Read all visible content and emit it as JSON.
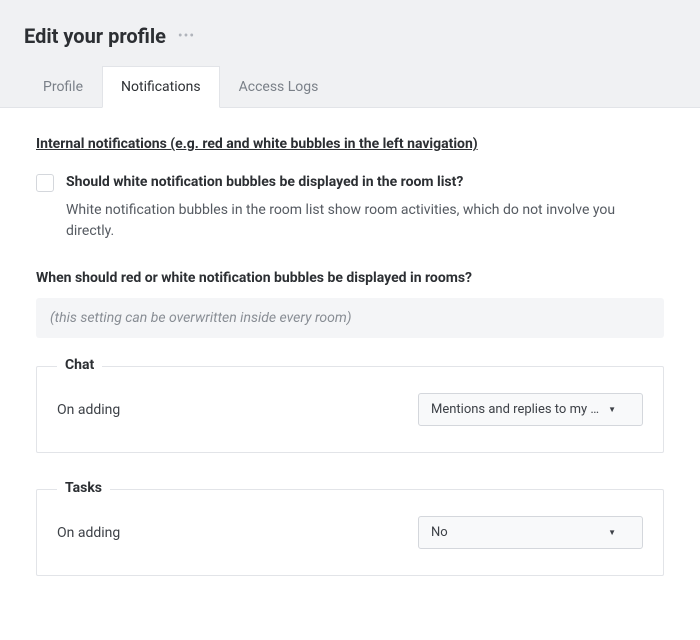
{
  "header": {
    "title": "Edit your profile"
  },
  "tabs": [
    {
      "label": "Profile",
      "active": false
    },
    {
      "label": "Notifications",
      "active": true
    },
    {
      "label": "Access Logs",
      "active": false
    }
  ],
  "section": {
    "heading": "Internal notifications (e.g. red and white bubbles in the left navigation)",
    "checkbox": {
      "label": "Should white notification bubbles be displayed in the room list?",
      "description": "White notification bubbles in the room list show room activities, which do not involve you directly.",
      "checked": false
    },
    "subheading": "When should red or white notification bubbles be displayed in rooms?",
    "info_note": "(this setting can be overwritten inside every room)"
  },
  "fieldsets": {
    "chat": {
      "legend": "Chat",
      "field_label": "On adding",
      "select_value": "Mentions and replies to my m…"
    },
    "tasks": {
      "legend": "Tasks",
      "field_label": "On adding",
      "select_value": "No"
    }
  }
}
